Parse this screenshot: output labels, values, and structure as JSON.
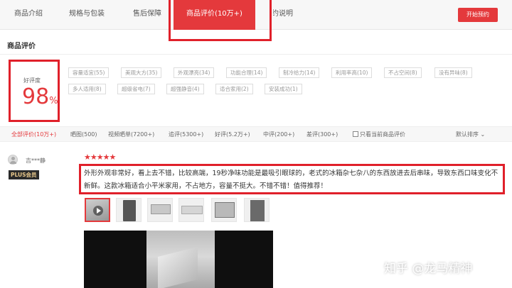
{
  "tabs": [
    {
      "label": "商品介绍"
    },
    {
      "label": "规格与包装"
    },
    {
      "label": "售后保障"
    },
    {
      "label": "商品评价(10万+)"
    },
    {
      "label": "预约说明"
    }
  ],
  "cta_label": "开始预约",
  "section_title": "商品评价",
  "rating": {
    "label": "好评度",
    "value": "98",
    "unit": "%"
  },
  "tags": [
    "容量适宜(55)",
    "美观大方(35)",
    "外观漂亮(34)",
    "功能合理(14)",
    "制冷给力(14)",
    "利用率高(10)",
    "不占空间(8)",
    "没有异味(8)",
    "多人适用(8)",
    "超级省电(7)",
    "超强静音(4)",
    "适合家用(2)",
    "安装成功(1)"
  ],
  "filters": [
    "全部评价(10万+)",
    "晒图(500)",
    "视频晒单(7200+)",
    "追评(5300+)",
    "好评(5.2万+)",
    "中评(200+)",
    "差评(300+)"
  ],
  "filter_checkbox_label": "只看当前商品评价",
  "sort_label": "默认排序",
  "review": {
    "user": "吉***静",
    "badge": "PLUS会员",
    "stars": "★★★★★",
    "text": "外形外观非常好，看上去不错，比较高端，19秒净味功能是最吸引眼球的，老式的冰箱杂七杂八的东西放进去后串味，导致东西口味变化不新鲜。这款冰箱适合小平米家用，不占地方，容量不挺大。不错不错！值得推荐！"
  },
  "watermark": "知乎 @龙马精神",
  "colors": {
    "accent": "#e4393c",
    "highlight_box": "#e0202a"
  }
}
